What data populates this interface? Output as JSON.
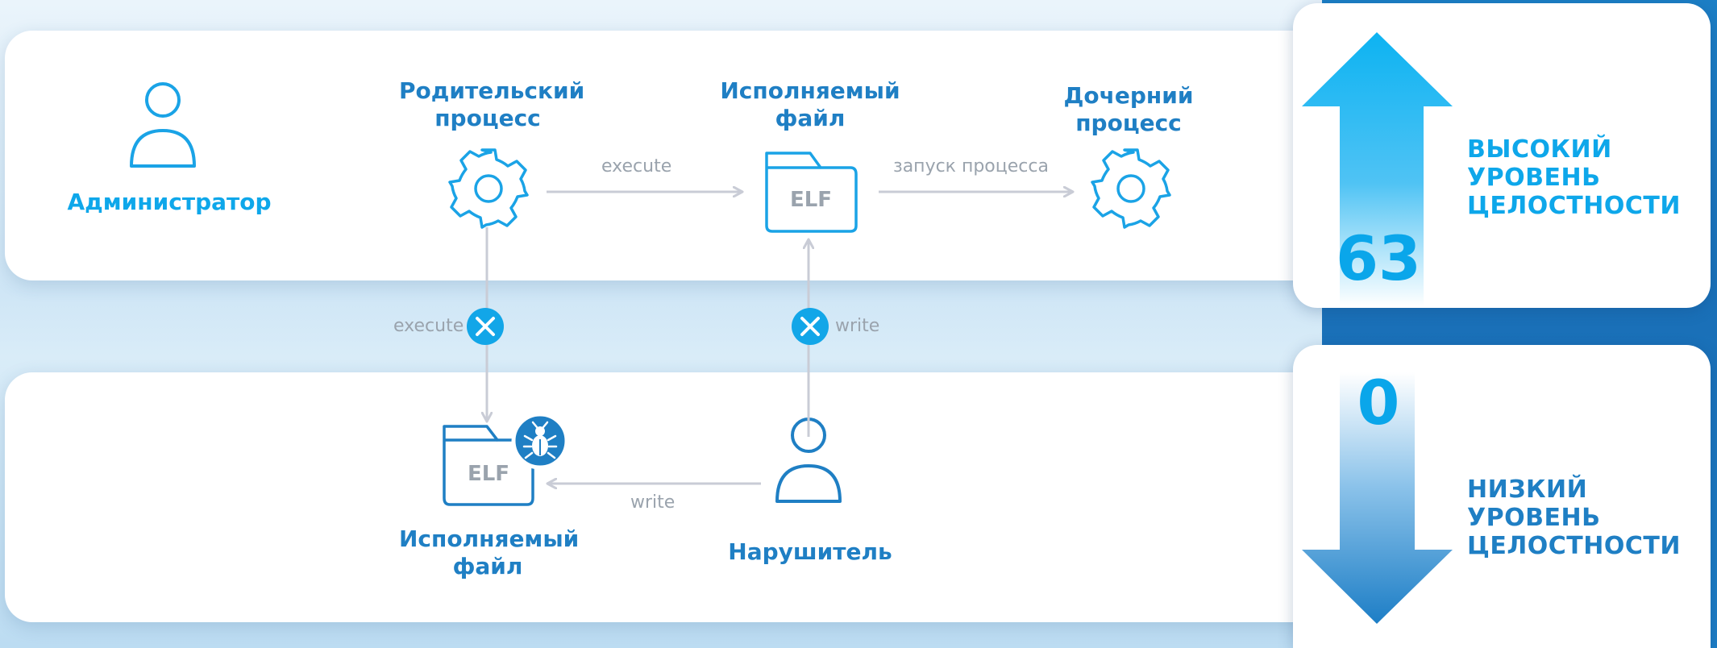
{
  "nodes": {
    "admin": "Администратор",
    "parent_process": "Родительский процесс",
    "exec_file_top": "Исполняемый файл",
    "child_process": "Дочерний процесс",
    "exec_file_bottom": "Исполняемый файл",
    "intruder": "Нарушитель"
  },
  "file_badge": "ELF",
  "edges": {
    "parent_to_file": "execute",
    "file_to_child": "запуск процесса",
    "parent_to_bad_file": "execute",
    "intruder_to_top_file": "write",
    "intruder_to_bad_file": "write"
  },
  "integrity": {
    "high_value": "63",
    "high_label_lines": [
      "ВЫСОКИЙ",
      "УРОВЕНЬ",
      "ЦЕЛОСТНОСТИ"
    ],
    "low_value": "0",
    "low_label_lines": [
      "НИЗКИЙ",
      "УРОВЕНЬ",
      "ЦЕЛОСТНОСТИ"
    ]
  },
  "colors": {
    "primary": "#1f7fc4",
    "accent": "#0ea7ea",
    "edge": "#c9ccd6",
    "edge_text": "#9aa3ad"
  },
  "icons": {
    "admin": "user-icon",
    "parent_process": "gear-icon",
    "child_process": "gear-icon",
    "file": "folder-file-icon",
    "blocked": "close-icon",
    "malware": "bug-icon",
    "intruder": "user-icon"
  }
}
